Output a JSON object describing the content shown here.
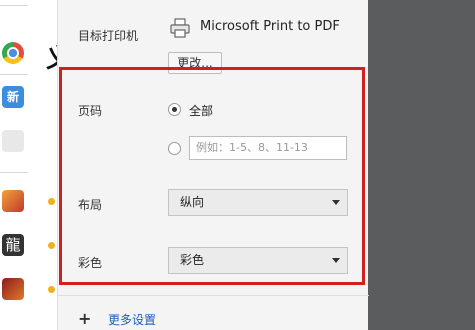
{
  "printer": {
    "label": "目标打印机",
    "name": "Microsoft Print to PDF",
    "change_label": "更改..."
  },
  "pages": {
    "label": "页码",
    "all_label": "全部",
    "all_selected": true,
    "custom_selected": false,
    "range_placeholder": "例如：1-5、8、11-13"
  },
  "layout": {
    "label": "布局",
    "value": "纵向"
  },
  "color": {
    "label": "彩色",
    "value": "彩色"
  },
  "more_settings": {
    "label": "更多设置"
  },
  "background": {
    "new_icon_text": "新",
    "game_icon_text": "龍",
    "partial_char": "义"
  },
  "colors": {
    "highlight": "#d11f1f",
    "link": "#1a5fb4",
    "panel_bg": "#f4f4f4",
    "backdrop": "#5a5c5e"
  },
  "icons": [
    "printer-icon",
    "plus-icon",
    "dropdown-arrow-icon",
    "chrome-icon"
  ]
}
